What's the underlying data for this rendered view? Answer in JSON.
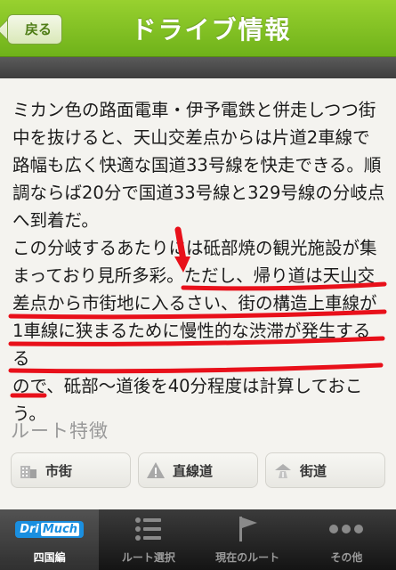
{
  "header": {
    "back_label": "戻る",
    "title": "ドライブ情報"
  },
  "content": {
    "paragraph1": "ミカン色の路面電車・伊予電鉄と併走しつつ街\n中を抜けると、天山交差点からは片道2車線で\n路幅も広く快適な国道33号線を快走できる。順\n調ならば20分で国道33号線と329号線の分岐点\nへ到着だ。",
    "paragraph2": "この分岐するあたりには砥部焼の観光施設が集\nまっており見所多彩。ただし、帰り道は天山交\n差点から市街地に入るさい、街の構造上車線が\n1車線に狭まるために慢性的な渋滞が発生するる\nので、砥部～道後を40分程度は計算しておこ\nう。"
  },
  "route_features": {
    "title": "ルート特徴",
    "items": [
      {
        "label": "市街",
        "icon": "building-icon"
      },
      {
        "label": "直線道",
        "icon": "warning-icon"
      },
      {
        "label": "街道",
        "icon": "road-icon"
      }
    ]
  },
  "tabbar": {
    "tabs": [
      {
        "label": "四国編",
        "icon": "drimuch-logo",
        "active": true
      },
      {
        "label": "ルート選択",
        "icon": "list-icon",
        "active": false
      },
      {
        "label": "現在のルート",
        "icon": "flag-icon",
        "active": false
      },
      {
        "label": "その他",
        "icon": "more-icon",
        "active": false
      }
    ],
    "logo_text_dri": "Dri",
    "logo_text_much": "Much"
  },
  "colors": {
    "header_green": "#7dbf22",
    "annotation_red": "#e8101a",
    "tabbar_dark": "#1f1f1f"
  }
}
